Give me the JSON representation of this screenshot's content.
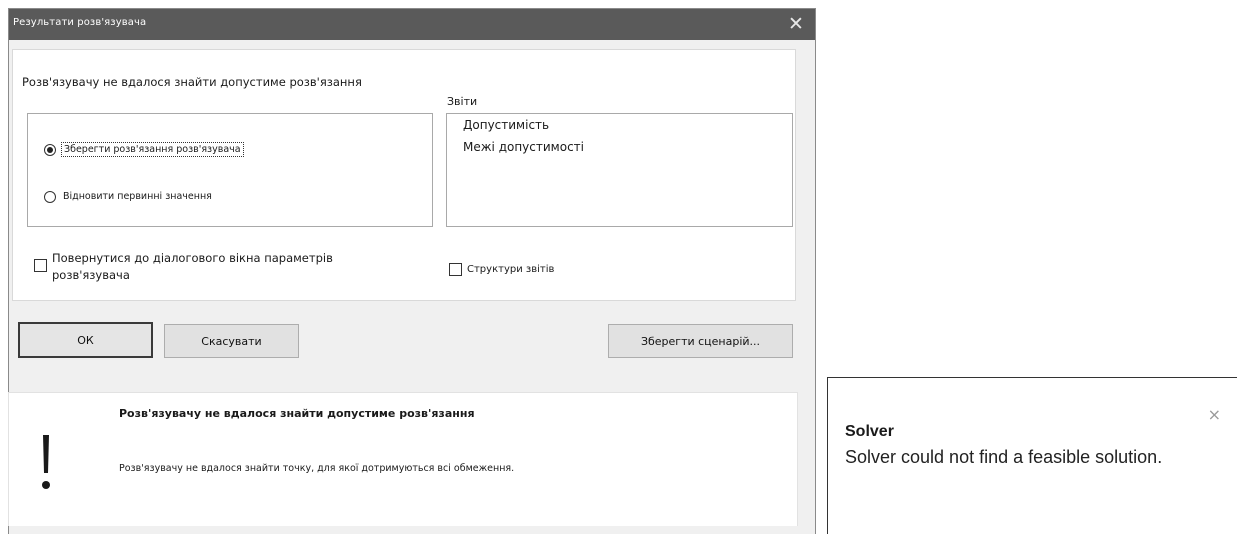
{
  "dialog": {
    "title": "Результати розв'язувача",
    "close_symbol": "✕",
    "message": "Розв'язувачу не вдалося знайти допустиме розв'язання",
    "options": [
      {
        "label": "Зберегти розв'язання розв'язувача",
        "selected": true
      },
      {
        "label": "Відновити первинні значення",
        "selected": false
      }
    ],
    "reports_label": "Звіти",
    "reports": [
      "Допустимість",
      "Межі допустимості"
    ],
    "return_checkbox_label": "Повернутися до діалогового вікна параметрів розв'язувача",
    "outline_checkbox_label": "Структури звітів",
    "buttons": {
      "ok": "ОК",
      "cancel": "Скасувати",
      "save_scenario": "Зберегти сценарій..."
    },
    "status_title": "Розв'язувачу не вдалося знайти допустиме розв'язання",
    "status_text": "Розв'язувачу не вдалося знайти точку, для якої дотримуються всі обмеження.",
    "status_icon": "exclamation-icon"
  },
  "tooltip": {
    "title": "Solver",
    "body": "Solver could not find a feasible solution.",
    "close_symbol": "×"
  },
  "colors": {
    "titlebar": "#5a5a5a",
    "dialog_bg": "#f0f0f0",
    "button_bg": "#e1e1e1"
  }
}
